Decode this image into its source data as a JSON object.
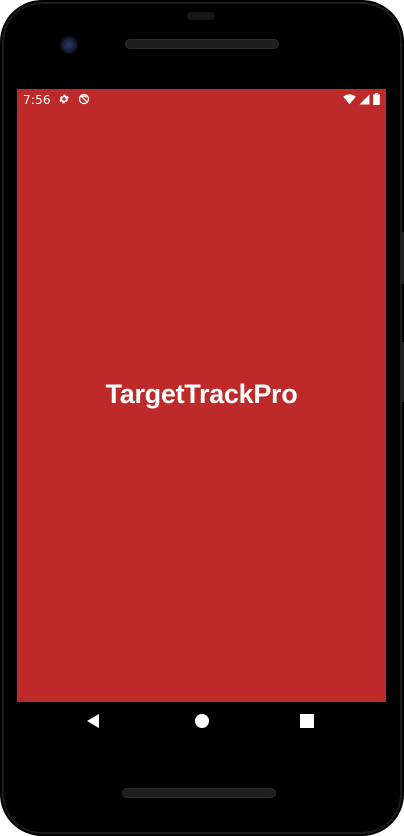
{
  "status_bar": {
    "time": "7:56",
    "left_icons": [
      "gear-icon",
      "sync-disabled-icon"
    ],
    "right_icons": [
      "wifi-icon",
      "cell-signal-icon",
      "battery-icon"
    ]
  },
  "app": {
    "title": "TargetTrackPro",
    "background_color": "#bd2a29",
    "title_color": "#ffffff"
  },
  "nav_bar": {
    "buttons": [
      {
        "icon": "back-triangle-icon"
      },
      {
        "icon": "home-circle-icon"
      },
      {
        "icon": "recents-square-icon"
      }
    ]
  }
}
